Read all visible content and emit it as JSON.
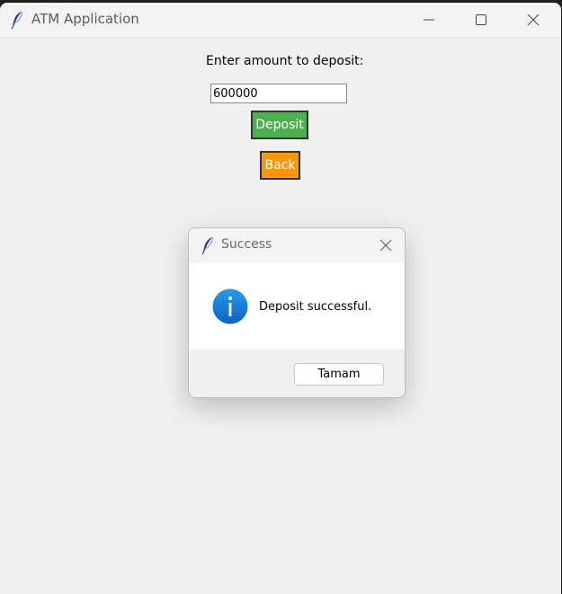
{
  "window": {
    "title": "ATM Application",
    "controls": [
      "minimize",
      "maximize",
      "close"
    ]
  },
  "form": {
    "prompt": "Enter amount to deposit:",
    "amount_value": "600000",
    "deposit_label": "Deposit",
    "back_label": "Back"
  },
  "dialog": {
    "title": "Success",
    "message": "Deposit successful.",
    "ok_label": "Tamam",
    "icon": "info-icon"
  },
  "colors": {
    "deposit_button": "#4caf50",
    "back_button": "#ff9800",
    "info_icon": "#1a7fd6"
  },
  "icons": {
    "app_icon": "feather-icon",
    "minimize": "minimize-icon",
    "maximize": "maximize-icon",
    "close": "close-icon"
  }
}
